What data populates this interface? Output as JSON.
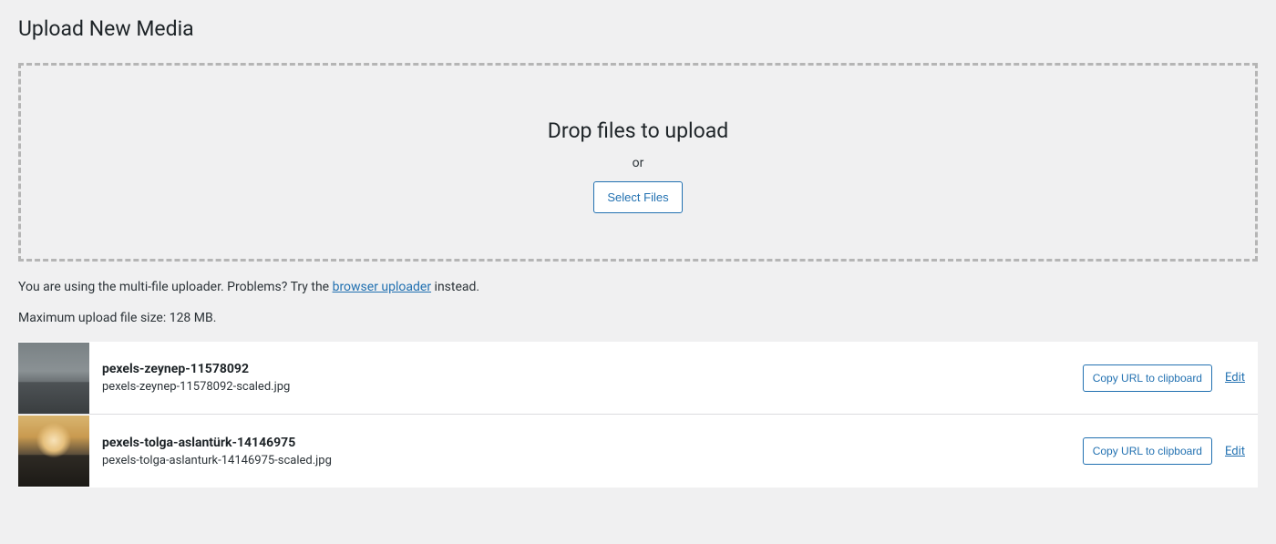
{
  "page_title": "Upload New Media",
  "dropzone": {
    "heading": "Drop files to upload",
    "or": "or",
    "button_label": "Select Files"
  },
  "info": {
    "prefix": "You are using the multi-file uploader. Problems? Try the ",
    "link_text": "browser uploader",
    "suffix": " instead."
  },
  "max_size": "Maximum upload file size: 128 MB.",
  "actions": {
    "copy_label": "Copy URL to clipboard",
    "edit_label": "Edit"
  },
  "media_items": [
    {
      "title": "pexels-zeynep-11578092",
      "filename": "pexels-zeynep-11578092-scaled.jpg"
    },
    {
      "title": "pexels-tolga-aslantürk-14146975",
      "filename": "pexels-tolga-aslanturk-14146975-scaled.jpg"
    }
  ]
}
